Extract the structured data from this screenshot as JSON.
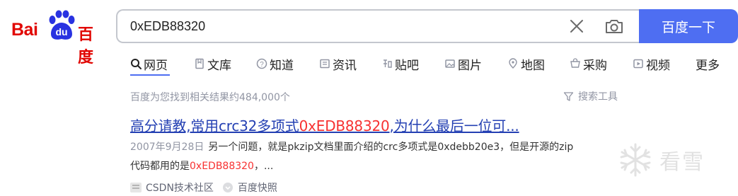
{
  "logo": {
    "text_left": "Bai",
    "paw_text": "du",
    "text_right": "百度"
  },
  "search": {
    "query": "0xEDB88320",
    "button_label": "百度一下"
  },
  "tabs": [
    {
      "label": "网页",
      "icon": "search-icon"
    },
    {
      "label": "文库",
      "icon": "doc-icon"
    },
    {
      "label": "知道",
      "icon": "question-icon"
    },
    {
      "label": "资讯",
      "icon": "news-icon"
    },
    {
      "label": "贴吧",
      "icon": "tieba-icon"
    },
    {
      "label": "图片",
      "icon": "image-icon"
    },
    {
      "label": "地图",
      "icon": "map-icon"
    },
    {
      "label": "采购",
      "icon": "cart-icon"
    },
    {
      "label": "视频",
      "icon": "video-icon"
    },
    {
      "label": "更多"
    }
  ],
  "meta": {
    "count_text": "百度为您找到相关结果约484,000个",
    "tools_label": "搜索工具"
  },
  "result": {
    "title_before": "高分请教,常用crc32多项式",
    "title_highlight": "0xEDB88320",
    "title_after": ",为什么最后一位可...",
    "date": "2007年9月28日",
    "snippet_line1": "另一个问题，就是pkzip文档里面介绍的crc多项式是0xdebb20e3，但是开源的zip",
    "snippet_line2_before": "代码都用的是",
    "snippet_line2_highlight": "0xEDB88320",
    "snippet_line2_after": "，...",
    "source": "CSDN技术社区",
    "snapshot": "百度快照"
  },
  "watermark": {
    "text": "看雪"
  },
  "colors": {
    "brand_red": "#e10602",
    "button_blue": "#4e6ef2",
    "link_blue": "#2440b3",
    "highlight_red": "#f73131"
  }
}
